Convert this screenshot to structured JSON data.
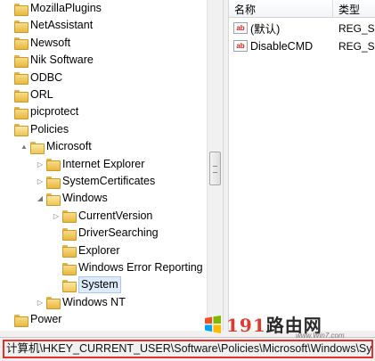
{
  "tree": {
    "items": [
      {
        "label": "MozillaPlugins",
        "level": 0,
        "arrow": "",
        "open": false
      },
      {
        "label": "NetAssistant",
        "level": 0,
        "arrow": "",
        "open": false
      },
      {
        "label": "Newsoft",
        "level": 0,
        "arrow": "",
        "open": false
      },
      {
        "label": "Nik Software",
        "level": 0,
        "arrow": "",
        "open": false
      },
      {
        "label": "ODBC",
        "level": 0,
        "arrow": "",
        "open": false
      },
      {
        "label": "ORL",
        "level": 0,
        "arrow": "",
        "open": false
      },
      {
        "label": "picprotect",
        "level": 0,
        "arrow": "",
        "open": false
      },
      {
        "label": "Policies",
        "level": 0,
        "arrow": "",
        "open": true
      },
      {
        "label": "Microsoft",
        "level": 1,
        "arrow": "▲",
        "open": true
      },
      {
        "label": "Internet Explorer",
        "level": 2,
        "arrow": "▷",
        "open": false
      },
      {
        "label": "SystemCertificates",
        "level": 2,
        "arrow": "▷",
        "open": false
      },
      {
        "label": "Windows",
        "level": 2,
        "arrow": "◢",
        "open": true
      },
      {
        "label": "CurrentVersion",
        "level": 3,
        "arrow": "▷",
        "open": false
      },
      {
        "label": "DriverSearching",
        "level": 3,
        "arrow": "",
        "open": false
      },
      {
        "label": "Explorer",
        "level": 3,
        "arrow": "",
        "open": false
      },
      {
        "label": "Windows Error Reporting",
        "level": 3,
        "arrow": "",
        "open": false
      },
      {
        "label": "System",
        "level": 3,
        "arrow": "",
        "open": true,
        "selected": true
      },
      {
        "label": "Windows NT",
        "level": 2,
        "arrow": "▷",
        "open": false
      },
      {
        "label": "Power",
        "level": 0,
        "arrow": "",
        "open": false
      }
    ]
  },
  "values": {
    "headers": {
      "name": "名称",
      "type": "类型"
    },
    "rows": [
      {
        "name": "(默认)",
        "type": "REG_SZ",
        "icon": "string-value-icon"
      },
      {
        "name": "DisableCMD",
        "type": "REG_SZ",
        "icon": "string-value-icon"
      }
    ]
  },
  "status": {
    "path": "计算机\\HKEY_CURRENT_USER\\Software\\Policies\\Microsoft\\Windows\\System"
  },
  "watermark": {
    "digits": "191",
    "brand": "路由网",
    "site": "www.Win7.com"
  },
  "colors": {
    "status_highlight": "#e4312b",
    "folder": "#e8b73e",
    "selection": "#dceaf9"
  }
}
